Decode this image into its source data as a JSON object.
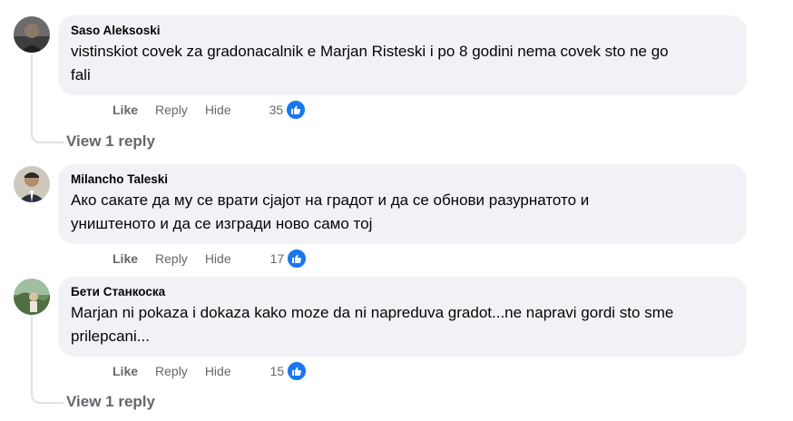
{
  "comments": [
    {
      "author": "Saso Aleksoski",
      "text_line1": "vistinskiot covek za gradonacalnik e Marjan Risteski i po 8 godini nema covek sto ne go",
      "text_line2": "fali",
      "actions": {
        "like": "Like",
        "reply": "Reply",
        "hide": "Hide"
      },
      "reactions": "35",
      "view_replies": "View 1 reply"
    },
    {
      "author": "Milancho Taleski",
      "text_line1": "Ако сакате да му се врати сјајот на градот и да се обнови разурнатото и",
      "text_line2": "уништеното и да се изгради ново само тој",
      "actions": {
        "like": "Like",
        "reply": "Reply",
        "hide": "Hide"
      },
      "reactions": "17"
    },
    {
      "author": "Бети Станкоска",
      "text_line1": "Marjan ni pokaza i dokaza kako moze da ni napreduva gradot...ne napravi gordi sto sme",
      "text_line2": "prilepcani...",
      "actions": {
        "like": "Like",
        "reply": "Reply",
        "hide": "Hide"
      },
      "reactions": "15",
      "view_replies": "View 1 reply"
    }
  ],
  "colors": {
    "bubble": "#f0f2f5",
    "muted_text": "#65676b",
    "like_blue": "#1877f2",
    "thread_line": "#dfe1e5"
  },
  "icons": [
    "thumbs-up-icon"
  ]
}
